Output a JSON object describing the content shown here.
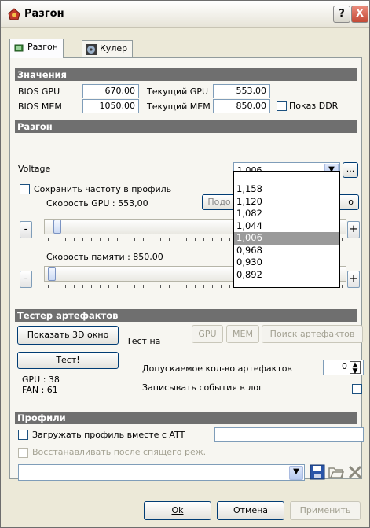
{
  "window": {
    "title": "Разгон",
    "help": "?",
    "close": "X"
  },
  "tabs": [
    {
      "label": "Разгон",
      "icon": "chip-icon"
    },
    {
      "label": "Кулер",
      "icon": "fan-icon"
    }
  ],
  "values_section": {
    "header": "Значения",
    "bios_gpu_label": "BIOS GPU",
    "bios_gpu_value": "670,00",
    "current_gpu_label": "Текущий GPU",
    "current_gpu_value": "553,00",
    "bios_mem_label": "BIOS MEM",
    "bios_mem_value": "1050,00",
    "current_mem_label": "Текущий MEM",
    "current_mem_value": "850,00",
    "show_ddr_label": "Показ DDR"
  },
  "overclock": {
    "header": "Разгон",
    "voltage_label": "Voltage",
    "voltage_value": "1,006",
    "voltage_more": "...",
    "save_freq_label": "Сохранить частоту в профиль",
    "gpu_speed_label": "Скорость GPU : 553,00",
    "hidden_button_left": "Подо",
    "hidden_button_right": "о",
    "mem_speed_label": "Скорость памяти : 850,00",
    "minus": "-",
    "plus": "+",
    "gpu_slider_level": 0.03,
    "mem_slider_level": 0.01,
    "voltage_options": [
      "1,158",
      "1,120",
      "1,082",
      "1,044",
      "1,006",
      "0,968",
      "0,930",
      "0,892"
    ],
    "voltage_selected_index": 4
  },
  "artifacts": {
    "header": "Тестер артефактов",
    "show_3d_label": "Показать 3D окно",
    "test_on_label": "Тест на",
    "gpu_btn": "GPU",
    "mem_btn": "MEM",
    "search_btn": "Поиск артефактов",
    "test_btn": "Тест!",
    "allowed_label": "Допускаемое кол-во артефактов",
    "allowed_value": "0",
    "gpu_temp": "GPU : 38",
    "fan": "FAN : 61",
    "log_label": "Записывать события в лог"
  },
  "profiles": {
    "header": "Профили",
    "load_with_att": "Загружать профиль вместе с ATT",
    "restore_after_sleep": "Восстанавливать после спящего реж."
  },
  "footer": {
    "ok": "Ok",
    "cancel": "Отмена",
    "apply": "Применить"
  }
}
